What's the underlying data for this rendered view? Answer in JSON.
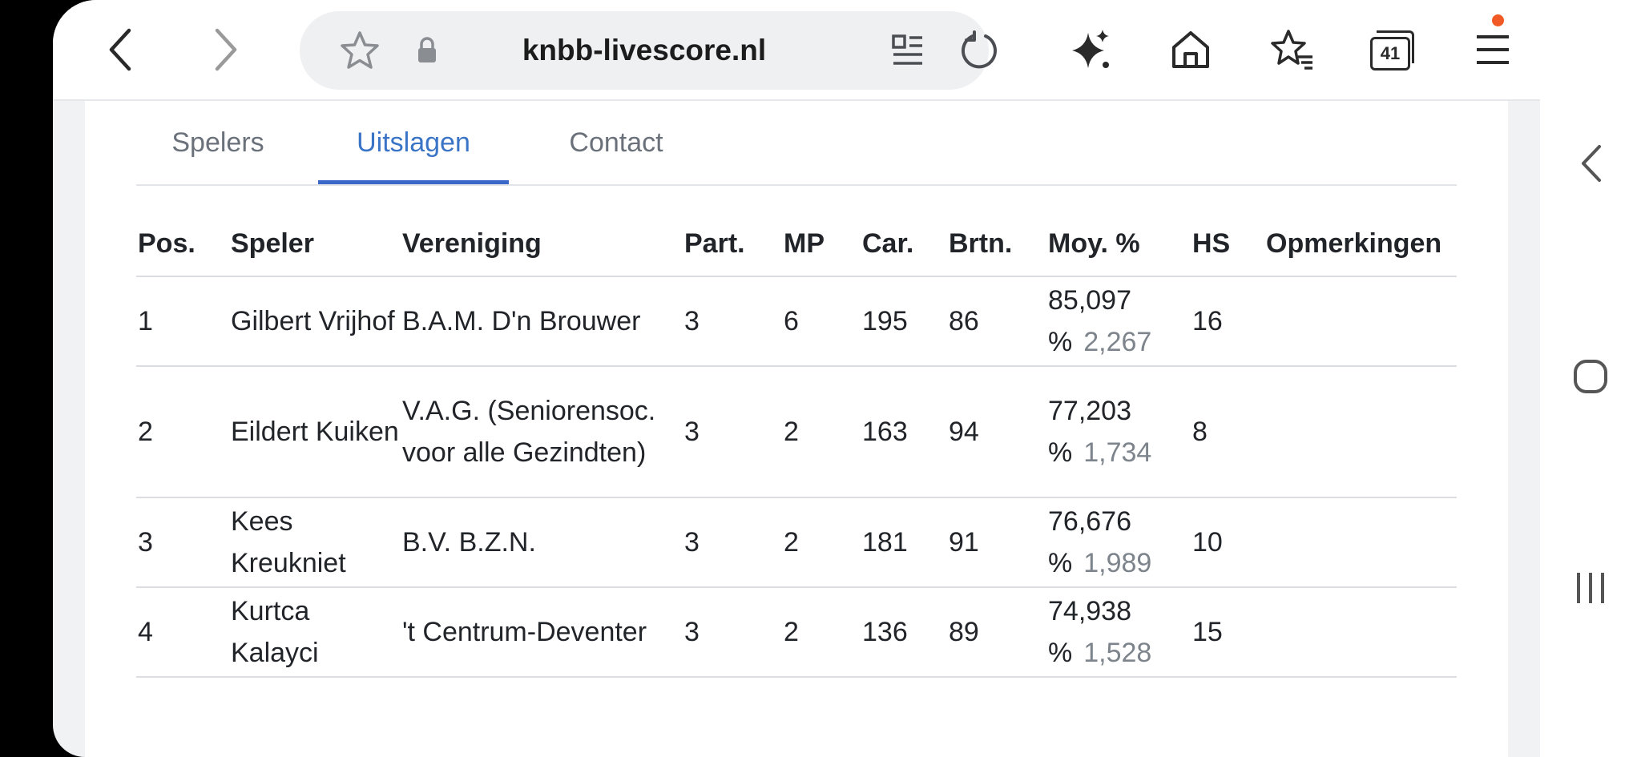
{
  "browser": {
    "url": "knbb-livescore.nl",
    "tab_count": "41",
    "icons": [
      "back-icon",
      "forward-icon",
      "star-icon",
      "lock-icon",
      "reader-icon",
      "reload-icon",
      "sparkle-icon",
      "home-icon",
      "bookmarks-icon",
      "tabs-icon",
      "menu-icon"
    ],
    "badge_color": "#f15a24"
  },
  "tabs": [
    {
      "label": "Spelers",
      "active": false
    },
    {
      "label": "Uitslagen",
      "active": true
    },
    {
      "label": "Contact",
      "active": false
    }
  ],
  "accent_color": "#3a74c7",
  "table": {
    "headers": [
      "Pos.",
      "Speler",
      "Vereniging",
      "Part.",
      "MP",
      "Car.",
      "Brtn.",
      "Moy. %",
      "HS",
      "Opmerkingen"
    ],
    "rows": [
      {
        "pos": "1",
        "speler": "Gilbert Vrijhof",
        "vereniging": "B.A.M. D'n Brouwer",
        "part": "3",
        "mp": "6",
        "car": "195",
        "brtn": "86",
        "pct": "85,097 %",
        "moy": "2,267",
        "hs": "16",
        "opm": ""
      },
      {
        "pos": "2",
        "speler": "Eildert Kuiken",
        "vereniging": "V.A.G. (Seniorensoc. voor alle Gezindten)",
        "part": "3",
        "mp": "2",
        "car": "163",
        "brtn": "94",
        "pct": "77,203 %",
        "moy": "1,734",
        "hs": "8",
        "opm": ""
      },
      {
        "pos": "3",
        "speler": "Kees Kreukniet",
        "vereniging": "B.V. B.Z.N.",
        "part": "3",
        "mp": "2",
        "car": "181",
        "brtn": "91",
        "pct": "76,676 %",
        "moy": "1,989",
        "hs": "10",
        "opm": ""
      },
      {
        "pos": "4",
        "speler": "Kurtca Kalayci",
        "vereniging": "'t Centrum-Deventer",
        "part": "3",
        "mp": "2",
        "car": "136",
        "brtn": "89",
        "pct": "74,938 %",
        "moy": "1,528",
        "hs": "15",
        "opm": ""
      }
    ]
  },
  "system_nav": {
    "icons": [
      "collapse-chevron-icon",
      "home-circle-icon",
      "recents-icon"
    ]
  }
}
